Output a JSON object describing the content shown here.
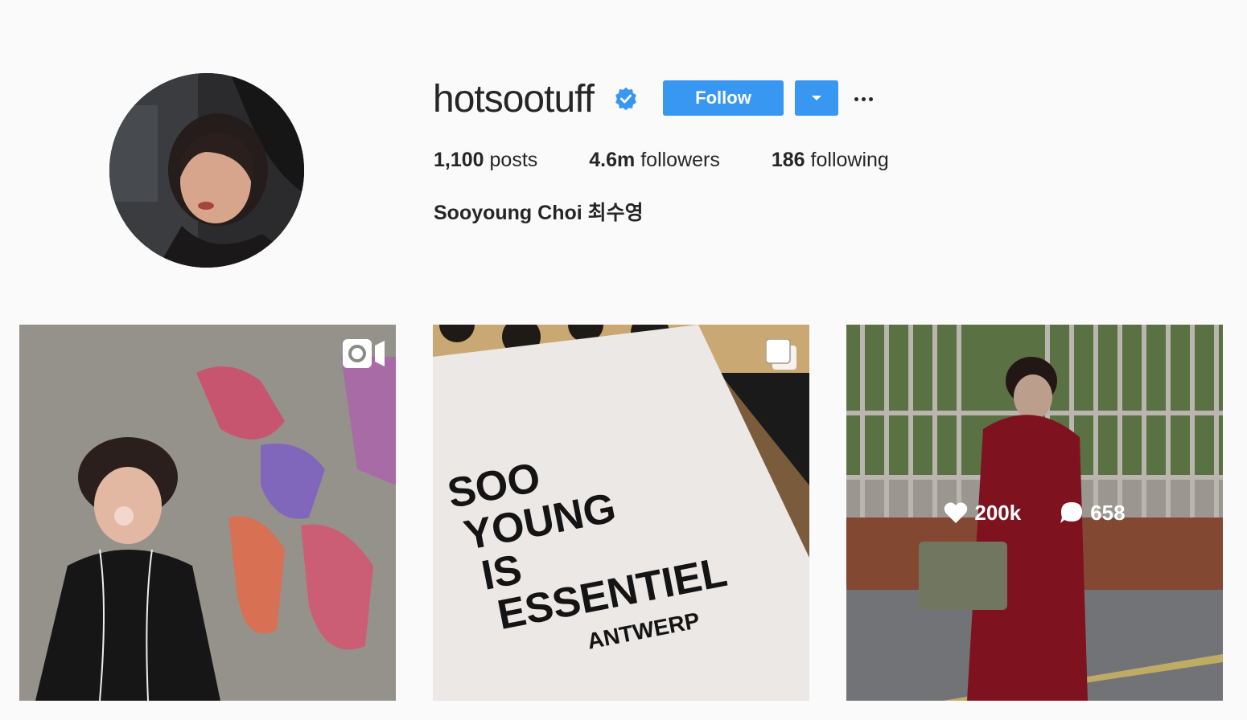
{
  "profile": {
    "username": "hotsootuff",
    "verified": true,
    "follow_label": "Follow",
    "full_name": "Sooyoung Choi 최수영",
    "stats": {
      "posts_count": "1,100",
      "posts_label": "posts",
      "followers_count": "4.6m",
      "followers_label": "followers",
      "following_count": "186",
      "following_label": "following"
    }
  },
  "posts": [
    {
      "type": "video",
      "icon": "video-camera-icon"
    },
    {
      "type": "carousel",
      "icon": "multiple-photos-icon"
    },
    {
      "type": "photo",
      "hovered": true,
      "likes": "200k",
      "comments": "658"
    }
  ],
  "colors": {
    "accent": "#3897f0",
    "verified": "#3897f0",
    "background": "#fafafa",
    "text": "#262626"
  }
}
